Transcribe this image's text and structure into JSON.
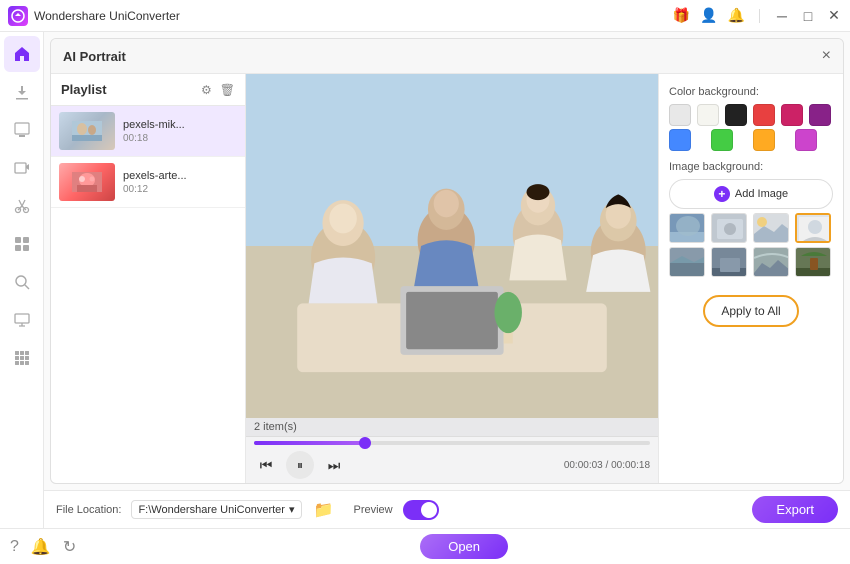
{
  "app": {
    "title": "Wondershare UniConverter",
    "logo_letter": "W"
  },
  "title_bar": {
    "icons": [
      "gift-icon",
      "user-icon",
      "notification-icon"
    ],
    "controls": [
      "minimize",
      "maximize",
      "close"
    ]
  },
  "dialog": {
    "title": "AI Portrait",
    "close_label": "×"
  },
  "playlist": {
    "title": "Playlist",
    "items": [
      {
        "name": "pexels-mik...",
        "duration": "00:18",
        "active": true
      },
      {
        "name": "pexels-arte...",
        "duration": "00:12",
        "active": false
      }
    ]
  },
  "video": {
    "items_count": "2 item(s)",
    "time_current": "00:00:03",
    "time_total": "00:00:18",
    "time_display": "00:00:03 / 00:00:18"
  },
  "right_panel": {
    "color_bg_label": "Color background:",
    "image_bg_label": "Image background:",
    "add_image_label": "Add Image",
    "colors_row1": [
      {
        "color": "#e8e8e8",
        "name": "white-swatch"
      },
      {
        "color": "#f5f5f0",
        "name": "light-swatch"
      },
      {
        "color": "#222222",
        "name": "black-swatch"
      },
      {
        "color": "#e84040",
        "name": "red-swatch"
      },
      {
        "color": "#cc2266",
        "name": "pink-swatch"
      },
      {
        "color": "#882288",
        "name": "purple-swatch"
      }
    ],
    "colors_row2": [
      {
        "color": "#4488ff",
        "name": "blue-swatch"
      },
      {
        "color": "#44cc44",
        "name": "green-swatch"
      },
      {
        "color": "#ffaa22",
        "name": "orange-swatch"
      },
      {
        "color": "#cc44cc",
        "name": "violet-swatch"
      }
    ],
    "image_thumbs": [
      {
        "bg": "#88aacc",
        "selected": false
      },
      {
        "bg": "#aabbcc",
        "selected": false
      },
      {
        "bg": "#ccddee",
        "selected": false
      },
      {
        "bg": "#ddeeff",
        "selected": true
      },
      {
        "bg": "#8899aa",
        "selected": false
      },
      {
        "bg": "#667788",
        "selected": false
      },
      {
        "bg": "#aabbaa",
        "selected": false
      },
      {
        "bg": "#556644",
        "selected": false
      }
    ],
    "apply_all_label": "Apply to All"
  },
  "bottom_bar": {
    "file_location_label": "File Location:",
    "file_path": "F:\\Wondershare UniConverter",
    "preview_label": "Preview",
    "export_label": "Export"
  },
  "very_bottom": {
    "open_label": "Open"
  },
  "sidebar": {
    "items": [
      {
        "icon": "🏠",
        "name": "home"
      },
      {
        "icon": "⬇",
        "name": "download"
      },
      {
        "icon": "⬆",
        "name": "upload"
      },
      {
        "icon": "🎞",
        "name": "video"
      },
      {
        "icon": "✂",
        "name": "cut"
      },
      {
        "icon": "⊞",
        "name": "grid"
      },
      {
        "icon": "🔍",
        "name": "magnify"
      },
      {
        "icon": "📺",
        "name": "screen"
      },
      {
        "icon": "⊞",
        "name": "apps"
      }
    ]
  }
}
